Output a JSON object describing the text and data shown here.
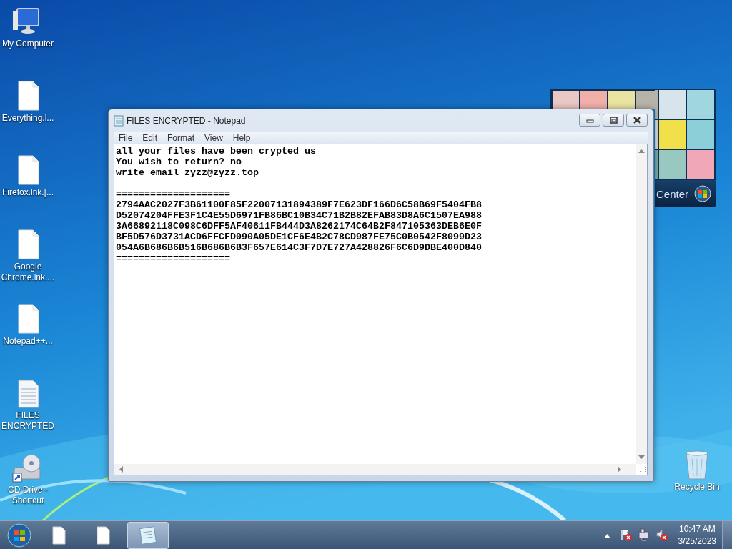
{
  "desktop_icons": [
    {
      "label": "My Computer",
      "kind": "computer"
    },
    {
      "label": "Everything.l...",
      "kind": "file"
    },
    {
      "label": "Firefox.lnk.[...",
      "kind": "file"
    },
    {
      "label": "Google Chrome.lnk....",
      "kind": "file"
    },
    {
      "label": "Notepad++...",
      "kind": "file"
    },
    {
      "label": "FILES ENCRYPTED",
      "kind": "text-file"
    },
    {
      "label": "CD Drive - Shortcut",
      "kind": "cd-drive"
    }
  ],
  "recycle_bin": {
    "label": "Recycle Bin"
  },
  "gadget": {
    "label": "Center"
  },
  "window": {
    "title": "FILES ENCRYPTED - Notepad",
    "menu": [
      "File",
      "Edit",
      "Format",
      "View",
      "Help"
    ],
    "paragraphs": [
      {
        "lines": [
          "all your files have been crypted us",
          "You wish to return? no",
          "write email zyzz@zyzz.top"
        ]
      },
      {
        "lines": [
          "====================",
          "2794AAC2027F3B61100F85F22007131894389F7E623DF166D6C58B69F5404FB8",
          "D52074204FFE3F1C4E55D6971FB86BC10B34C71B2B82EFAB83D8A6C1507EA988",
          "3A66892118C098C6DFF5AF40611FB444D3A8262174C64B2F847105363DEB6E0F",
          "BF5D576D3731ACD6FFCFD090A05DE1CF6E4B2C78CD987FE75C0B0542F8099D23",
          "054A6B686B6B516B686B6B3F657E614C3F7D7E727A428826F6C6D9DBE400D840",
          "===================="
        ]
      }
    ]
  },
  "taskbar": {
    "items": [
      {
        "kind": "file",
        "active": false
      },
      {
        "kind": "file",
        "active": false
      },
      {
        "kind": "notepad",
        "active": true
      }
    ],
    "tray": [
      {
        "kind": "flag",
        "error": true
      },
      {
        "kind": "network",
        "error": false
      },
      {
        "kind": "speaker",
        "error": true
      }
    ],
    "time": "10:47 AM",
    "date": "3/25/2023"
  }
}
